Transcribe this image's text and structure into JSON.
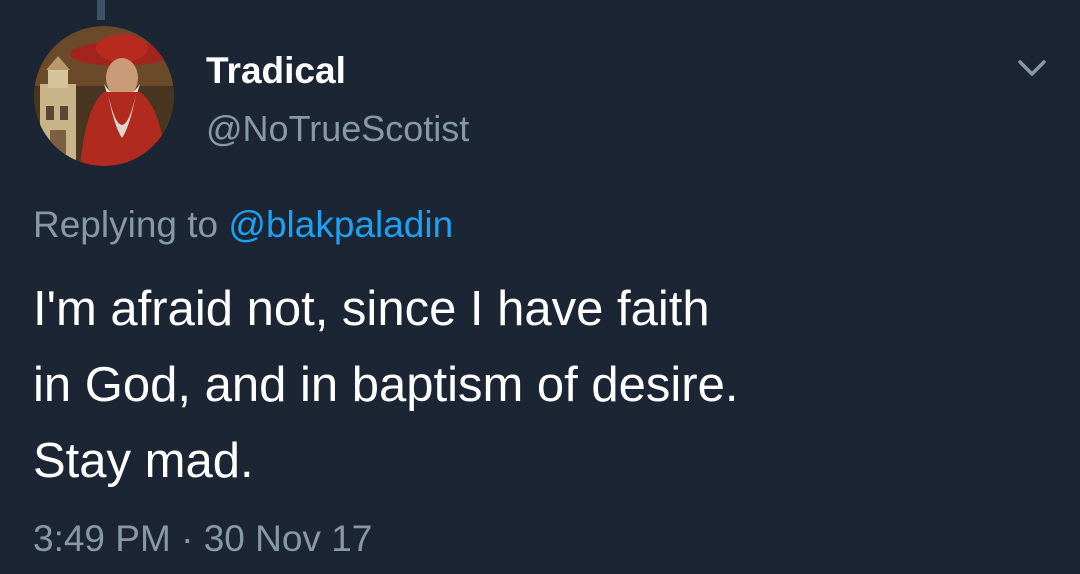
{
  "tweet": {
    "author": {
      "display_name": "Tradical",
      "handle": "@NoTrueScotist",
      "avatar_icon": "avatar-portrait-icon"
    },
    "menu_icon": "chevron-down-icon",
    "reply": {
      "prefix": "Replying to ",
      "mention": "@blakpaladin"
    },
    "text_lines": [
      "I'm afraid not, since I have faith",
      "in God, and in baptism of desire.",
      "Stay mad."
    ],
    "time": "3:49 PM",
    "separator": " · ",
    "date": "30 Nov 17"
  },
  "colors": {
    "background": "#1c2533",
    "primary_text": "#ffffff",
    "secondary_text": "#8899a6",
    "link": "#1da1f2",
    "thread_line": "#3d5466"
  }
}
